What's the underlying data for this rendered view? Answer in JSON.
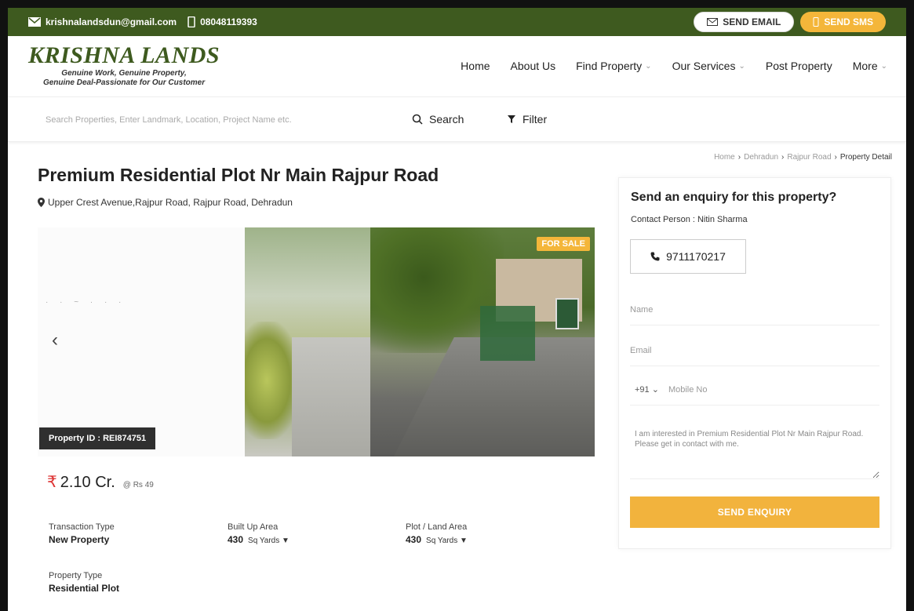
{
  "topbar": {
    "email": "krishnalandsdun@gmail.com",
    "phone": "08048119393",
    "send_email": "SEND EMAIL",
    "send_sms": "SEND SMS"
  },
  "brand": {
    "name": "KRISHNA LANDS",
    "tagline_1": "Genuine Work, Genuine Property,",
    "tagline_2": "Genuine Deal-Passionate for Our Customer",
    "color": "#3e5a1f"
  },
  "nav": [
    {
      "label": "Home"
    },
    {
      "label": "About Us"
    },
    {
      "label": "Find Property"
    },
    {
      "label": "Our Services"
    },
    {
      "label": "Post Property"
    },
    {
      "label": "More"
    }
  ],
  "search": {
    "placeholder": "Search Properties, Enter Landmark, Location, Project Name etc.",
    "search_label": "Search",
    "filter_label": "Filter"
  },
  "breadcrumb": {
    "home": "Home",
    "city": "Dehradun",
    "locality": "Rajpur Road",
    "current": "Property Detail"
  },
  "property": {
    "title": "Premium Residential Plot Nr Main Rajpur Road",
    "address": "Upper Crest Avenue,Rajpur Road, Rajpur Road, Dehradun",
    "badge": "FOR SALE",
    "id_label": "Property ID : REI874751",
    "price": "2.10 Cr.",
    "rate": "@ Rs 49",
    "details": [
      {
        "label": "Transaction Type",
        "value": "New Property",
        "unit": ""
      },
      {
        "label": "Built Up Area",
        "value": "430",
        "unit": "Sq Yards ▼"
      },
      {
        "label": "Plot / Land Area",
        "value": "430",
        "unit": "Sq Yards ▼"
      },
      {
        "label": "Property Type",
        "value": "Residential Plot",
        "unit": ""
      }
    ]
  },
  "enquiry": {
    "heading": "Send an enquiry for this property?",
    "contact_person": "Contact Person : Nitin Sharma",
    "phone": "9711170217",
    "name_placeholder": "Name",
    "email_placeholder": "Email",
    "country_code": "+91 ⌄",
    "mobile_placeholder": "Mobile No",
    "message": "I am interested in Premium Residential Plot Nr Main Rajpur Road. Please get in contact with me.",
    "submit": "SEND ENQUIRY",
    "accent": "#f2b33d"
  }
}
